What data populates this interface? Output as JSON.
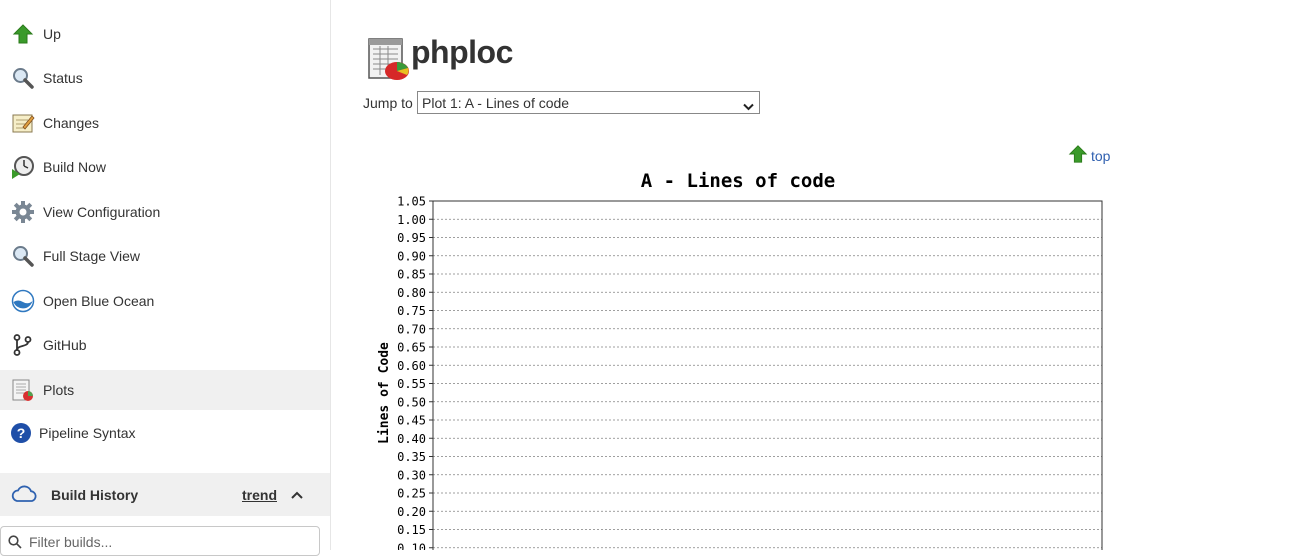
{
  "sidebar": {
    "items": [
      {
        "label": "Up",
        "icon": "up-arrow-icon"
      },
      {
        "label": "Status",
        "icon": "magnifier-icon"
      },
      {
        "label": "Changes",
        "icon": "notepad-icon"
      },
      {
        "label": "Build Now",
        "icon": "clock-play-icon"
      },
      {
        "label": "View Configuration",
        "icon": "gear-icon"
      },
      {
        "label": "Full Stage View",
        "icon": "magnifier-icon"
      },
      {
        "label": "Open Blue Ocean",
        "icon": "blue-ocean-icon"
      },
      {
        "label": "GitHub",
        "icon": "git-branch-icon"
      },
      {
        "label": "Plots",
        "icon": "plot-icon",
        "active": true
      },
      {
        "label": "Pipeline Syntax",
        "icon": "help-icon"
      }
    ],
    "build_history": {
      "title": "Build History",
      "trend_label": "trend",
      "filter_placeholder": "Filter builds..."
    }
  },
  "main": {
    "title": "phploc",
    "jump_label": "Jump to",
    "jump_selected": "Plot 1: A - Lines of code",
    "top_link": "top"
  },
  "colors": {
    "arrow_green": "#3a9a2a",
    "link_blue": "#3060b0",
    "active_bg": "#f0f0f0",
    "grid": "#808080"
  },
  "chart_data": {
    "type": "line",
    "title": "A - Lines of code",
    "xlabel": "",
    "ylabel": "Lines of Code",
    "ylim": [
      0.1,
      1.05
    ],
    "yticks": [
      "1.05",
      "1.00",
      "0.95",
      "0.90",
      "0.85",
      "0.80",
      "0.75",
      "0.70",
      "0.65",
      "0.60",
      "0.55",
      "0.50",
      "0.45",
      "0.40",
      "0.35",
      "0.30",
      "0.25",
      "0.20",
      "0.15",
      "0.10"
    ],
    "grid": true,
    "series": []
  }
}
